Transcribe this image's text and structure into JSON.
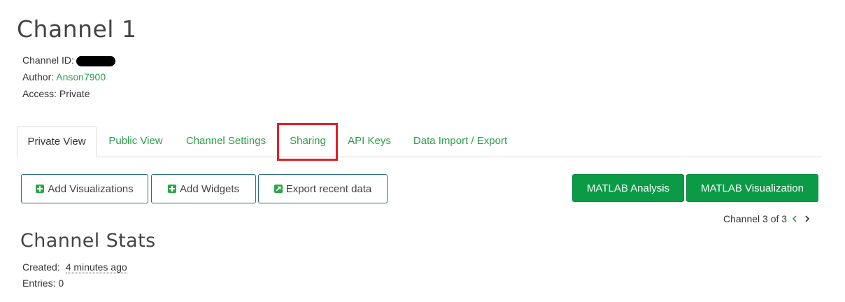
{
  "channel": {
    "title": "Channel 1",
    "id_label": "Channel ID:",
    "author_label": "Author:",
    "author": "Anson7900",
    "access_label": "Access:",
    "access": "Private"
  },
  "tabs": [
    {
      "label": "Private View",
      "active": true
    },
    {
      "label": "Public View"
    },
    {
      "label": "Channel Settings"
    },
    {
      "label": "Sharing",
      "highlighted": true
    },
    {
      "label": "API Keys"
    },
    {
      "label": "Data Import / Export"
    }
  ],
  "actions": {
    "add_visualizations": "Add Visualizations",
    "add_widgets": "Add Widgets",
    "export_recent": "Export recent data",
    "matlab_analysis": "MATLAB Analysis",
    "matlab_visualization": "MATLAB Visualization"
  },
  "pager": {
    "text": "Channel 3 of 3"
  },
  "stats": {
    "title": "Channel Stats",
    "created_label": "Created:",
    "created": "4 minutes ago",
    "entries_label": "Entries:",
    "entries": "0"
  },
  "colors": {
    "accent_green": "#0b9b47",
    "link_green": "#2e9e4a",
    "highlight_red": "#e21f26"
  }
}
